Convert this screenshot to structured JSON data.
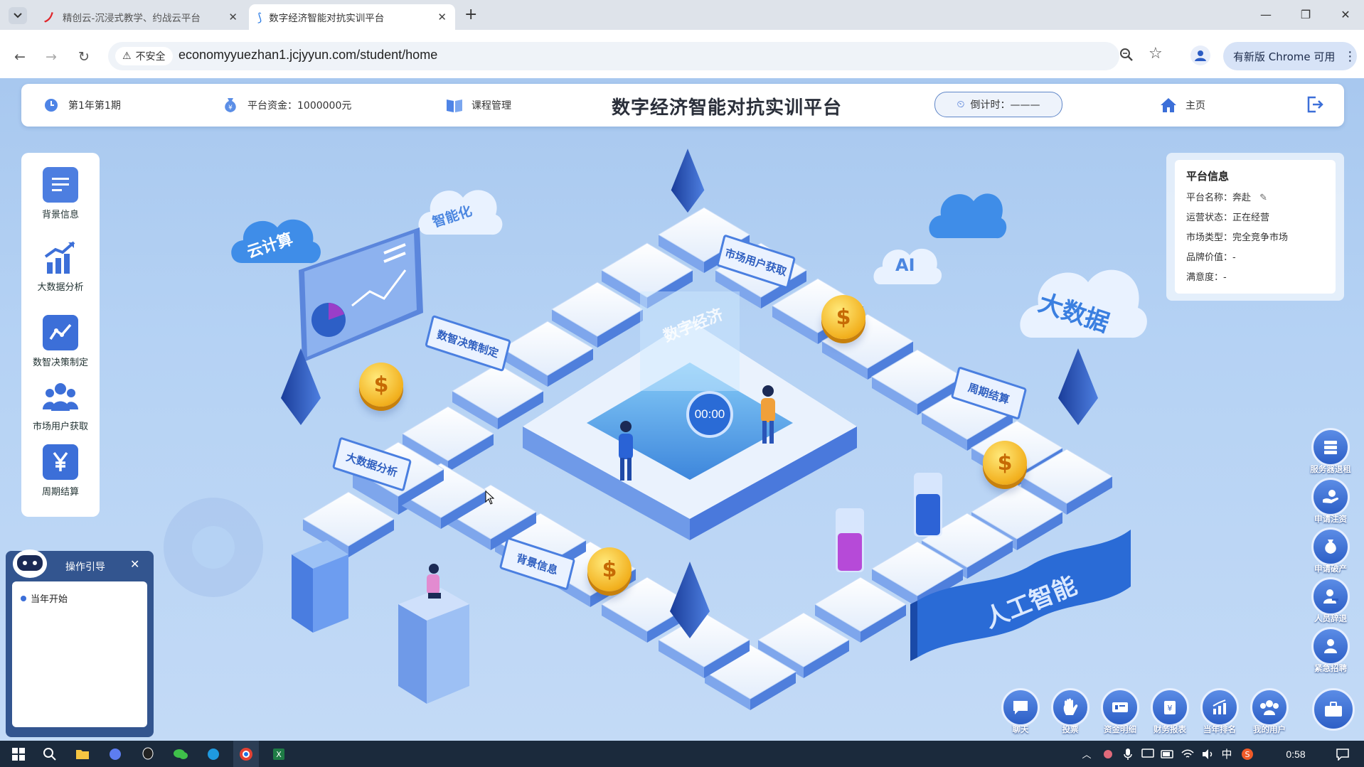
{
  "browser": {
    "tabs": [
      {
        "title": "精创云-沉浸式教学、约战云平台",
        "active": false
      },
      {
        "title": "数字经济智能对抗实训平台",
        "active": true
      }
    ],
    "insecure_label": "不安全",
    "url": "economyyuezhan1.jcjyyun.com/student/home",
    "update_label": "有新版 Chrome 可用"
  },
  "header": {
    "period": "第1年第1期",
    "funds": "平台资金：1000000元",
    "course": "课程管理",
    "title": "数字经济智能对抗实训平台",
    "countdown": "倒计时：———",
    "home": "主页"
  },
  "left_menu": [
    {
      "label": "背景信息",
      "icon": "document-icon",
      "color": "#4d7ee0"
    },
    {
      "label": "大数据分析",
      "icon": "chart-bar-icon",
      "color": "#3c6fd8"
    },
    {
      "label": "数智决策制定",
      "icon": "line-chart-icon",
      "color": "#3c6fd8"
    },
    {
      "label": "市场用户获取",
      "icon": "users-icon",
      "color": "#3c6fd8"
    },
    {
      "label": "周期结算",
      "icon": "yen-icon",
      "color": "#3c6fd8"
    }
  ],
  "platform_info": {
    "heading": "平台信息",
    "rows": [
      {
        "label": "平台名称：",
        "value": "奔赴"
      },
      {
        "label": "运营状态：",
        "value": "正在经营"
      },
      {
        "label": "市场类型：",
        "value": "完全竞争市场"
      },
      {
        "label": "品牌价值：",
        "value": "-"
      },
      {
        "label": "满意度：",
        "value": "-"
      }
    ]
  },
  "guide": {
    "title": "操作引导",
    "items": [
      "当年开始"
    ]
  },
  "board": {
    "clouds": [
      "云计算",
      "智能化",
      "AI",
      "大数据"
    ],
    "signs": [
      "数智决策制定",
      "市场用户获取",
      "周期结算",
      "大数据分析",
      "背景信息"
    ],
    "center_label": "数字经济",
    "timer": "00:00",
    "banner": "人工智能",
    "coin_symbol": "$"
  },
  "right_buttons": [
    {
      "label": "服务器退租",
      "icon": "server-icon"
    },
    {
      "label": "申请注资",
      "icon": "hand-coin-icon"
    },
    {
      "label": "申请破产",
      "icon": "money-bag-icon"
    },
    {
      "label": "人员辞退",
      "icon": "user-minus-icon"
    },
    {
      "label": "紧急招聘",
      "icon": "user-add-icon"
    }
  ],
  "bottom_buttons": [
    {
      "label": "聊天",
      "icon": "chat-icon"
    },
    {
      "label": "投票",
      "icon": "hand-icon"
    },
    {
      "label": "资金明细",
      "icon": "funds-icon"
    },
    {
      "label": "财务报表",
      "icon": "report-icon"
    },
    {
      "label": "当年排名",
      "icon": "ranking-icon"
    },
    {
      "label": "我的用户",
      "icon": "group-icon"
    }
  ],
  "taskbar": {
    "time": "0:58",
    "ime": "中"
  },
  "colors": {
    "accent": "#3c6fd8",
    "page_bg": "#b5d2f4",
    "guide_bg": "#33558f"
  }
}
